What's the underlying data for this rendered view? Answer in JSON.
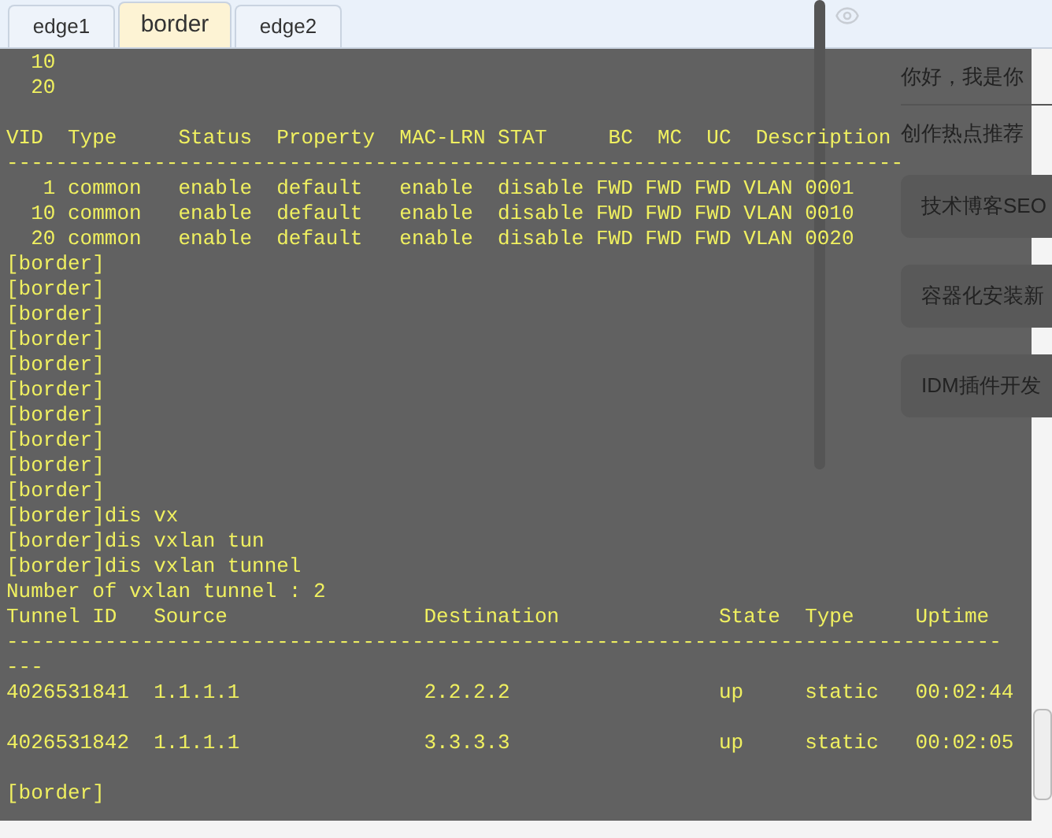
{
  "tabs": [
    {
      "label": "edge1",
      "selected": false
    },
    {
      "label": "border",
      "selected": true
    },
    {
      "label": "edge2",
      "selected": false
    }
  ],
  "terminal": {
    "lines": [
      {
        "kind": "text",
        "text": "  10"
      },
      {
        "kind": "text",
        "text": "  20"
      },
      {
        "kind": "blank"
      },
      {
        "kind": "text",
        "text": "VID  Type     Status  Property  MAC-LRN STAT     BC  MC  UC  Description"
      },
      {
        "kind": "text",
        "text": "-------------------------------------------------------------------------"
      },
      {
        "kind": "text",
        "text": "   1 common   enable  default   enable  disable FWD FWD FWD VLAN 0001"
      },
      {
        "kind": "text",
        "text": "  10 common   enable  default   enable  disable FWD FWD FWD VLAN 0010"
      },
      {
        "kind": "text",
        "text": "  20 common   enable  default   enable  disable FWD FWD FWD VLAN 0020"
      },
      {
        "kind": "text",
        "text": "[border]"
      },
      {
        "kind": "text",
        "text": "[border]"
      },
      {
        "kind": "text",
        "text": "[border]"
      },
      {
        "kind": "text",
        "text": "[border]"
      },
      {
        "kind": "text",
        "text": "[border]"
      },
      {
        "kind": "text",
        "text": "[border]"
      },
      {
        "kind": "text",
        "text": "[border]"
      },
      {
        "kind": "text",
        "text": "[border]"
      },
      {
        "kind": "text",
        "text": "[border]"
      },
      {
        "kind": "text",
        "text": "[border]"
      },
      {
        "kind": "text",
        "text": "[border]dis vx"
      },
      {
        "kind": "text",
        "text": "[border]dis vxlan tun"
      },
      {
        "kind": "text",
        "text": "[border]dis vxlan tunnel"
      },
      {
        "kind": "text",
        "text": "Number of vxlan tunnel : 2"
      },
      {
        "kind": "text",
        "text": "Tunnel ID   Source                Destination             State  Type     Uptime"
      },
      {
        "kind": "text",
        "text": "---------------------------------------------------------------------------------"
      },
      {
        "kind": "text",
        "text": "---"
      },
      {
        "kind": "text",
        "text": "4026531841  1.1.1.1               2.2.2.2                 up     static   00:02:44"
      },
      {
        "kind": "blank"
      },
      {
        "kind": "text",
        "text": "4026531842  1.1.1.1               3.3.3.3                 up     static   00:02:05"
      },
      {
        "kind": "blank"
      },
      {
        "kind": "text",
        "text": "[border]"
      }
    ]
  },
  "side_panel": {
    "greeting": "你好，我是你",
    "heading": "创作热点推荐",
    "cards": [
      "技术博客SEO",
      "容器化安装新",
      "IDM插件开发"
    ]
  }
}
